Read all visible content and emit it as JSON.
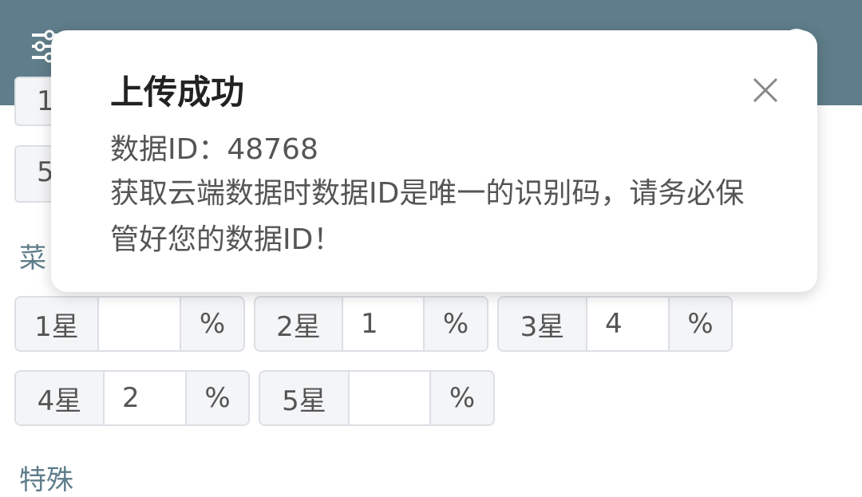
{
  "header": {
    "menu_icon": "sliders-icon",
    "settings_icon": "gear-icon",
    "color": "#5f7d8a"
  },
  "background": {
    "partial_row1_text": "1",
    "partial_row2_text": "5",
    "section_label_1": "菜",
    "section_label_2": "特殊"
  },
  "star_inputs": [
    {
      "label": "1星",
      "value": "",
      "unit": "%"
    },
    {
      "label": "2星",
      "value": "1",
      "unit": "%"
    },
    {
      "label": "3星",
      "value": "4",
      "unit": "%"
    },
    {
      "label": "4星",
      "value": "2",
      "unit": "%"
    },
    {
      "label": "5星",
      "value": "",
      "unit": "%"
    }
  ],
  "dialog": {
    "title": "上传成功",
    "data_id_line": "数据ID：48768",
    "message": "获取云端数据时数据ID是唯一的识别码，请务必保管好您的数据ID！",
    "close_icon": "close-icon"
  }
}
